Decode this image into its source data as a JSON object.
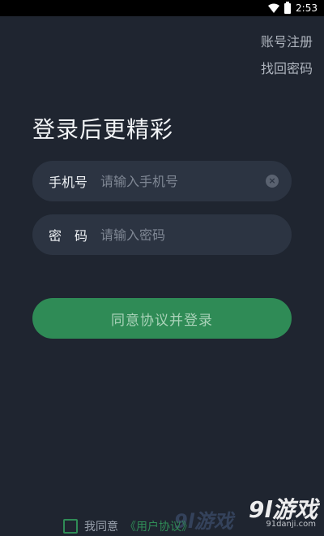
{
  "status_bar": {
    "time": "2:53"
  },
  "header": {
    "register_link": "账号注册",
    "recover_link": "找回密码"
  },
  "main": {
    "headline": "登录后更精彩",
    "phone": {
      "label": "手机号",
      "placeholder": "请输入手机号"
    },
    "password": {
      "label": "密　码",
      "placeholder": "请输入密码"
    },
    "login_button": "同意协议并登录"
  },
  "agreement": {
    "prefix": "我同意",
    "link": "《用户协议》"
  },
  "watermark": {
    "logo": "9l游戏",
    "sub": "91danji.com",
    "faint": "9l游戏"
  },
  "colors": {
    "background": "#1f2530",
    "field": "#2c3442",
    "accent": "#2f8b56"
  }
}
